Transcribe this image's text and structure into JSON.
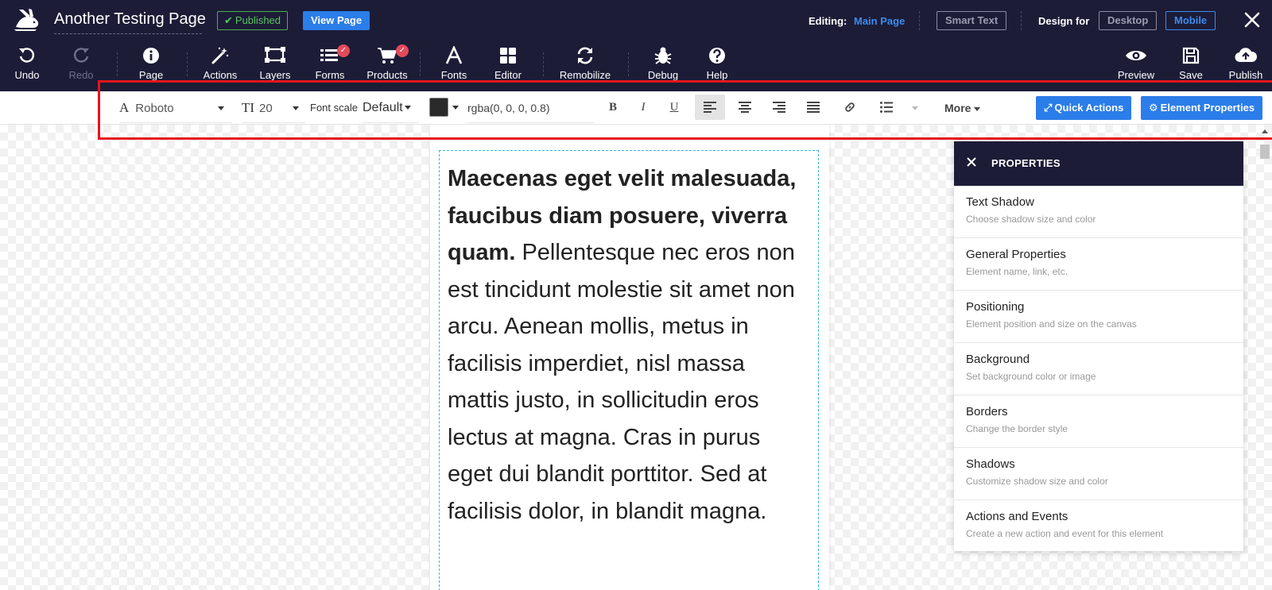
{
  "header": {
    "site_title": "Another Testing Page",
    "published_label": "Published",
    "view_page_label": "View Page",
    "editing_label": "Editing:",
    "editing_value": "Main Page",
    "smart_text_label": "Smart Text",
    "design_for_label": "Design for",
    "desktop_label": "Desktop",
    "mobile_label": "Mobile"
  },
  "toolbar": {
    "undo": "Undo",
    "redo": "Redo",
    "page": "Page",
    "actions": "Actions",
    "layers": "Layers",
    "forms": "Forms",
    "products": "Products",
    "fonts": "Fonts",
    "editor": "Editor",
    "remobilize": "Remobilize",
    "debug": "Debug",
    "help": "Help",
    "preview": "Preview",
    "save": "Save",
    "publish": "Publish"
  },
  "format": {
    "font_family": "Roboto",
    "font_size": "20",
    "font_scale_label": "Font scale",
    "font_scale_value": "Default",
    "color_value": "rgba(0, 0, 0, 0.8)",
    "bold": "B",
    "italic": "I",
    "underline": "U",
    "more_label": "More",
    "quick_actions_label": "Quick Actions",
    "element_properties_label": "Element Properties"
  },
  "content": {
    "bold_text": "Maecenas eget velit malesuada, faucibus diam posuere, viverra quam.",
    "body_text": " Pellentesque nec eros non est tincidunt molestie sit amet non arcu. Aenean mollis, metus in facilisis imperdiet, nisl massa mattis justo, in sollicitudin eros lectus at magna. Cras in purus eget dui blandit porttitor. Sed at facilisis dolor, in blandit magna."
  },
  "properties": {
    "title": "PROPERTIES",
    "items": [
      {
        "title": "Text Shadow",
        "desc": "Choose shadow size and color"
      },
      {
        "title": "General Properties",
        "desc": "Element name, link, etc."
      },
      {
        "title": "Positioning",
        "desc": "Element position and size on the canvas"
      },
      {
        "title": "Background",
        "desc": "Set background color or image"
      },
      {
        "title": "Borders",
        "desc": "Change the border style"
      },
      {
        "title": "Shadows",
        "desc": "Customize shadow size and color"
      },
      {
        "title": "Actions and Events",
        "desc": "Create a new action and event for this element"
      }
    ]
  },
  "colors": {
    "nav_bg": "#1c1c37",
    "accent": "#2b7de9",
    "published_green": "#59c65d",
    "highlight_red": "#e6141b",
    "selection_dashed": "#2fb6e6"
  }
}
